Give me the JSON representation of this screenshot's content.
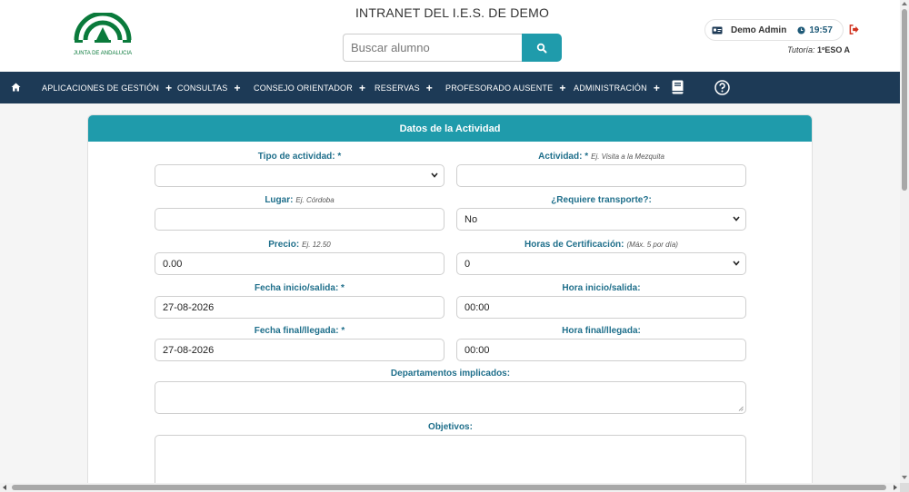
{
  "header": {
    "site_title": "INTRANET DEL I.E.S. DE DEMO",
    "logo_text": "JUNTA DE ANDALUCIA",
    "search_placeholder": "Buscar alumno",
    "user_name": "Demo Admin",
    "time": "19:57",
    "tutoria_label": "Tutoría:",
    "tutoria_value": "1ºESO A"
  },
  "nav": {
    "items": [
      {
        "label": "APLICACIONES DE GESTIÓN"
      },
      {
        "label": "CONSULTAS"
      },
      {
        "label": "CONSEJO ORIENTADOR"
      },
      {
        "label": "RESERVAS"
      },
      {
        "label": "PROFESORADO AUSENTE"
      },
      {
        "label": "ADMINISTRACIÓN"
      }
    ],
    "plus": "+"
  },
  "form": {
    "title": "Datos de la Actividad",
    "tipo_label": "Tipo de actividad: *",
    "tipo_value": "",
    "actividad_label": "Actividad: *",
    "actividad_hint": "Ej. Visita a la Mezquita",
    "actividad_value": "",
    "lugar_label": "Lugar:",
    "lugar_hint": "Ej. Córdoba",
    "lugar_value": "",
    "transporte_label": "¿Requiere transporte?:",
    "transporte_value": "No",
    "precio_label": "Precio:",
    "precio_hint": "Ej. 12.50",
    "precio_value": "0.00",
    "horas_label": "Horas de Certificación:",
    "horas_hint": "(Máx. 5 por día)",
    "horas_value": "0",
    "fecha_inicio_label": "Fecha inicio/salida: *",
    "fecha_inicio_value": "27-08-2026",
    "hora_inicio_label": "Hora inicio/salida:",
    "hora_inicio_value": "00:00",
    "fecha_final_label": "Fecha final/llegada: *",
    "fecha_final_value": "27-08-2026",
    "hora_final_label": "Hora final/llegada:",
    "hora_final_value": "00:00",
    "departamentos_label": "Departamentos implicados:",
    "objetivos_label": "Objetivos:"
  },
  "colors": {
    "navbar": "#1d3a56",
    "accent": "#1f9bab",
    "label": "#1f6f8b"
  },
  "icons": [
    "home-icon",
    "search-icon",
    "id-card-icon",
    "clock-icon",
    "logout-icon",
    "book-icon",
    "help-icon",
    "chevron-down-icon"
  ]
}
